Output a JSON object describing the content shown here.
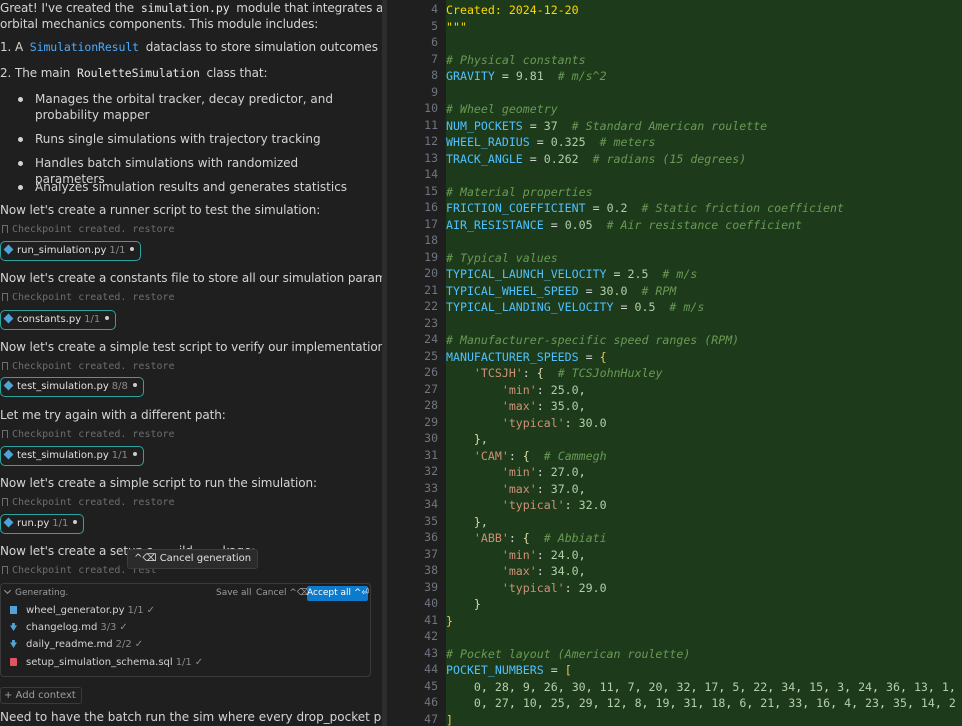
{
  "chat": {
    "intro_line1_a": "Great! I've created the ",
    "intro_line1_code": "simulation.py",
    "intro_line1_b": " module that integrates all our",
    "intro_line2": "orbital mechanics components. This module includes:",
    "item1_a": "1. A ",
    "item1_code": "SimulationResult",
    "item1_b": " dataclass to store simulation outcomes",
    "item2_a": "2. The main ",
    "item2_code": "RouletteSimulation",
    "item2_b": " class that:",
    "bullets": [
      "Manages the orbital tracker, decay predictor, and probability mapper",
      "Runs single simulations with trajectory tracking",
      "Handles batch simulations with randomized parameters",
      "Analyzes simulation results and generates statistics"
    ],
    "messages": [
      "Now let's create a runner script to test the simulation:",
      "Now let's create a constants file to store all our simulation parameters:",
      "Now let's create a simple test script to verify our implementation:",
      "Let me try again with a different path:",
      "Now let's create a simple script to run the simulation:",
      "Now let's create a setup s... ...ild ... ...kage:"
    ],
    "checkpoint_text": "Checkpoint created. restore",
    "chips": [
      {
        "name": "run_simulation.py",
        "count": "1/1"
      },
      {
        "name": "constants.py",
        "count": "1/1"
      },
      {
        "name": "test_simulation.py",
        "count": "8/8"
      },
      {
        "name": "test_simulation.py",
        "count": "1/1"
      },
      {
        "name": "run.py",
        "count": "1/1"
      }
    ],
    "cancel_tooltip": "^⌫ Cancel generation",
    "checkpoint_partial": "Checkpoint created. rest"
  },
  "generating": {
    "label": "Generating.",
    "save_all": "Save all",
    "cancel_all": "Cancel ^⌫",
    "accept_all": "Accept all ^⏎",
    "files": [
      {
        "name": "wheel_generator.py",
        "count": "1/1",
        "icon_color": "#4fa3d6"
      },
      {
        "name": "changelog.md",
        "count": "3/3",
        "icon_color": "#4fa3d6"
      },
      {
        "name": "daily_readme.md",
        "count": "2/2",
        "icon_color": "#4fa3d6"
      },
      {
        "name": "setup_simulation_schema.sql",
        "count": "1/1",
        "icon_color": "#e05561"
      }
    ],
    "check": "✓"
  },
  "input": {
    "add_context": "+ Add context",
    "text": "Need to have the batch run the sim where every drop_pocket position is"
  },
  "editor": {
    "line_numbers": [
      "4",
      "5",
      "6",
      "7",
      "8",
      "9",
      "10",
      "11",
      "12",
      "13",
      "14",
      "15",
      "16",
      "17",
      "18",
      "19",
      "20",
      "21",
      "22",
      "23",
      "24",
      "25",
      "26",
      "27",
      "28",
      "29",
      "30",
      "31",
      "32",
      "33",
      "34",
      "35",
      "36",
      "37",
      "38",
      "39",
      "40",
      "41",
      "42",
      "43",
      "44",
      "45",
      "46",
      "47"
    ],
    "lines": [
      [
        [
          "p",
          "Created: 2024-12-20"
        ]
      ],
      [
        [
          "p",
          "\"\"\""
        ]
      ],
      [],
      [
        [
          "c",
          "# Physical constants"
        ]
      ],
      [
        [
          "v",
          "GRAVITY"
        ],
        [
          "o",
          " = "
        ],
        [
          "n",
          "9.81"
        ],
        [
          "o",
          "  "
        ],
        [
          "c",
          "# m/s^2"
        ]
      ],
      [],
      [
        [
          "c",
          "# Wheel geometry"
        ]
      ],
      [
        [
          "v",
          "NUM_POCKETS"
        ],
        [
          "o",
          " = "
        ],
        [
          "n",
          "37"
        ],
        [
          "o",
          "  "
        ],
        [
          "c",
          "# Standard American roulette"
        ]
      ],
      [
        [
          "v",
          "WHEEL_RADIUS"
        ],
        [
          "o",
          " = "
        ],
        [
          "n",
          "0.325"
        ],
        [
          "o",
          "  "
        ],
        [
          "c",
          "# meters"
        ]
      ],
      [
        [
          "v",
          "TRACK_ANGLE"
        ],
        [
          "o",
          " = "
        ],
        [
          "n",
          "0.262"
        ],
        [
          "o",
          "  "
        ],
        [
          "c",
          "# radians (15 degrees)"
        ]
      ],
      [],
      [
        [
          "c",
          "# Material properties"
        ]
      ],
      [
        [
          "v",
          "FRICTION_COEFFICIENT"
        ],
        [
          "o",
          " = "
        ],
        [
          "n",
          "0.2"
        ],
        [
          "o",
          "  "
        ],
        [
          "c",
          "# Static friction coefficient"
        ]
      ],
      [
        [
          "v",
          "AIR_RESISTANCE"
        ],
        [
          "o",
          " = "
        ],
        [
          "n",
          "0.05"
        ],
        [
          "o",
          "  "
        ],
        [
          "c",
          "# Air resistance coefficient"
        ]
      ],
      [],
      [
        [
          "c",
          "# Typical values"
        ]
      ],
      [
        [
          "v",
          "TYPICAL_LAUNCH_VELOCITY"
        ],
        [
          "o",
          " = "
        ],
        [
          "n",
          "2.5"
        ],
        [
          "o",
          "  "
        ],
        [
          "c",
          "# m/s"
        ]
      ],
      [
        [
          "v",
          "TYPICAL_WHEEL_SPEED"
        ],
        [
          "o",
          " = "
        ],
        [
          "n",
          "30.0"
        ],
        [
          "o",
          "  "
        ],
        [
          "c",
          "# RPM"
        ]
      ],
      [
        [
          "v",
          "TYPICAL_LANDING_VELOCITY"
        ],
        [
          "o",
          " = "
        ],
        [
          "n",
          "0.5"
        ],
        [
          "o",
          "  "
        ],
        [
          "c",
          "# m/s"
        ]
      ],
      [],
      [
        [
          "c",
          "# Manufacturer-specific speed ranges (RPM)"
        ]
      ],
      [
        [
          "v",
          "MANUFACTURER_SPEEDS"
        ],
        [
          "o",
          " = "
        ],
        [
          "y",
          "{"
        ]
      ],
      [
        [
          "o",
          "    "
        ],
        [
          "s",
          "'TCSJH'"
        ],
        [
          "o",
          ": "
        ],
        [
          "k",
          "{"
        ],
        [
          "o",
          "  "
        ],
        [
          "c",
          "# TCSJohnHuxley"
        ]
      ],
      [
        [
          "o",
          "        "
        ],
        [
          "s",
          "'min'"
        ],
        [
          "o",
          ": "
        ],
        [
          "n",
          "25.0"
        ],
        [
          "o",
          ","
        ]
      ],
      [
        [
          "o",
          "        "
        ],
        [
          "s",
          "'max'"
        ],
        [
          "o",
          ": "
        ],
        [
          "n",
          "35.0"
        ],
        [
          "o",
          ","
        ]
      ],
      [
        [
          "o",
          "        "
        ],
        [
          "s",
          "'typical'"
        ],
        [
          "o",
          ": "
        ],
        [
          "n",
          "30.0"
        ]
      ],
      [
        [
          "o",
          "    "
        ],
        [
          "k",
          "}"
        ],
        [
          "o",
          ","
        ]
      ],
      [
        [
          "o",
          "    "
        ],
        [
          "s",
          "'CAM'"
        ],
        [
          "o",
          ": "
        ],
        [
          "k",
          "{"
        ],
        [
          "o",
          "  "
        ],
        [
          "c",
          "# Cammegh"
        ]
      ],
      [
        [
          "o",
          "        "
        ],
        [
          "s",
          "'min'"
        ],
        [
          "o",
          ": "
        ],
        [
          "n",
          "27.0"
        ],
        [
          "o",
          ","
        ]
      ],
      [
        [
          "o",
          "        "
        ],
        [
          "s",
          "'max'"
        ],
        [
          "o",
          ": "
        ],
        [
          "n",
          "37.0"
        ],
        [
          "o",
          ","
        ]
      ],
      [
        [
          "o",
          "        "
        ],
        [
          "s",
          "'typical'"
        ],
        [
          "o",
          ": "
        ],
        [
          "n",
          "32.0"
        ]
      ],
      [
        [
          "o",
          "    "
        ],
        [
          "k",
          "}"
        ],
        [
          "o",
          ","
        ]
      ],
      [
        [
          "o",
          "    "
        ],
        [
          "s",
          "'ABB'"
        ],
        [
          "o",
          ": "
        ],
        [
          "k",
          "{"
        ],
        [
          "o",
          "  "
        ],
        [
          "c",
          "# Abbiati"
        ]
      ],
      [
        [
          "o",
          "        "
        ],
        [
          "s",
          "'min'"
        ],
        [
          "o",
          ": "
        ],
        [
          "n",
          "24.0"
        ],
        [
          "o",
          ","
        ]
      ],
      [
        [
          "o",
          "        "
        ],
        [
          "s",
          "'max'"
        ],
        [
          "o",
          ": "
        ],
        [
          "n",
          "34.0"
        ],
        [
          "o",
          ","
        ]
      ],
      [
        [
          "o",
          "        "
        ],
        [
          "s",
          "'typical'"
        ],
        [
          "o",
          ": "
        ],
        [
          "n",
          "29.0"
        ]
      ],
      [
        [
          "o",
          "    "
        ],
        [
          "k",
          "}"
        ]
      ],
      [
        [
          "y",
          "}"
        ]
      ],
      [],
      [
        [
          "c",
          "# Pocket layout (American roulette)"
        ]
      ],
      [
        [
          "v",
          "POCKET_NUMBERS"
        ],
        [
          "o",
          " = "
        ],
        [
          "y",
          "["
        ]
      ],
      [
        [
          "o",
          "    "
        ],
        [
          "n",
          "0"
        ],
        [
          "o",
          ", "
        ],
        [
          "n",
          "28"
        ],
        [
          "o",
          ", "
        ],
        [
          "n",
          "9"
        ],
        [
          "o",
          ", "
        ],
        [
          "n",
          "26"
        ],
        [
          "o",
          ", "
        ],
        [
          "n",
          "30"
        ],
        [
          "o",
          ", "
        ],
        [
          "n",
          "11"
        ],
        [
          "o",
          ", "
        ],
        [
          "n",
          "7"
        ],
        [
          "o",
          ", "
        ],
        [
          "n",
          "20"
        ],
        [
          "o",
          ", "
        ],
        [
          "n",
          "32"
        ],
        [
          "o",
          ", "
        ],
        [
          "n",
          "17"
        ],
        [
          "o",
          ", "
        ],
        [
          "n",
          "5"
        ],
        [
          "o",
          ", "
        ],
        [
          "n",
          "22"
        ],
        [
          "o",
          ", "
        ],
        [
          "n",
          "34"
        ],
        [
          "o",
          ", "
        ],
        [
          "n",
          "15"
        ],
        [
          "o",
          ", "
        ],
        [
          "n",
          "3"
        ],
        [
          "o",
          ", "
        ],
        [
          "n",
          "24"
        ],
        [
          "o",
          ", "
        ],
        [
          "n",
          "36"
        ],
        [
          "o",
          ", "
        ],
        [
          "n",
          "13"
        ],
        [
          "o",
          ", "
        ],
        [
          "n",
          "1"
        ],
        [
          "o",
          ","
        ]
      ],
      [
        [
          "o",
          "    "
        ],
        [
          "n",
          "0"
        ],
        [
          "o",
          ", "
        ],
        [
          "n",
          "27"
        ],
        [
          "o",
          ", "
        ],
        [
          "n",
          "10"
        ],
        [
          "o",
          ", "
        ],
        [
          "n",
          "25"
        ],
        [
          "o",
          ", "
        ],
        [
          "n",
          "29"
        ],
        [
          "o",
          ", "
        ],
        [
          "n",
          "12"
        ],
        [
          "o",
          ", "
        ],
        [
          "n",
          "8"
        ],
        [
          "o",
          ", "
        ],
        [
          "n",
          "19"
        ],
        [
          "o",
          ", "
        ],
        [
          "n",
          "31"
        ],
        [
          "o",
          ", "
        ],
        [
          "n",
          "18"
        ],
        [
          "o",
          ", "
        ],
        [
          "n",
          "6"
        ],
        [
          "o",
          ", "
        ],
        [
          "n",
          "21"
        ],
        [
          "o",
          ", "
        ],
        [
          "n",
          "33"
        ],
        [
          "o",
          ", "
        ],
        [
          "n",
          "16"
        ],
        [
          "o",
          ", "
        ],
        [
          "n",
          "4"
        ],
        [
          "o",
          ", "
        ],
        [
          "n",
          "23"
        ],
        [
          "o",
          ", "
        ],
        [
          "n",
          "35"
        ],
        [
          "o",
          ", "
        ],
        [
          "n",
          "14"
        ],
        [
          "o",
          ", "
        ],
        [
          "n",
          "2"
        ]
      ],
      [
        [
          "y",
          "]"
        ]
      ]
    ]
  }
}
